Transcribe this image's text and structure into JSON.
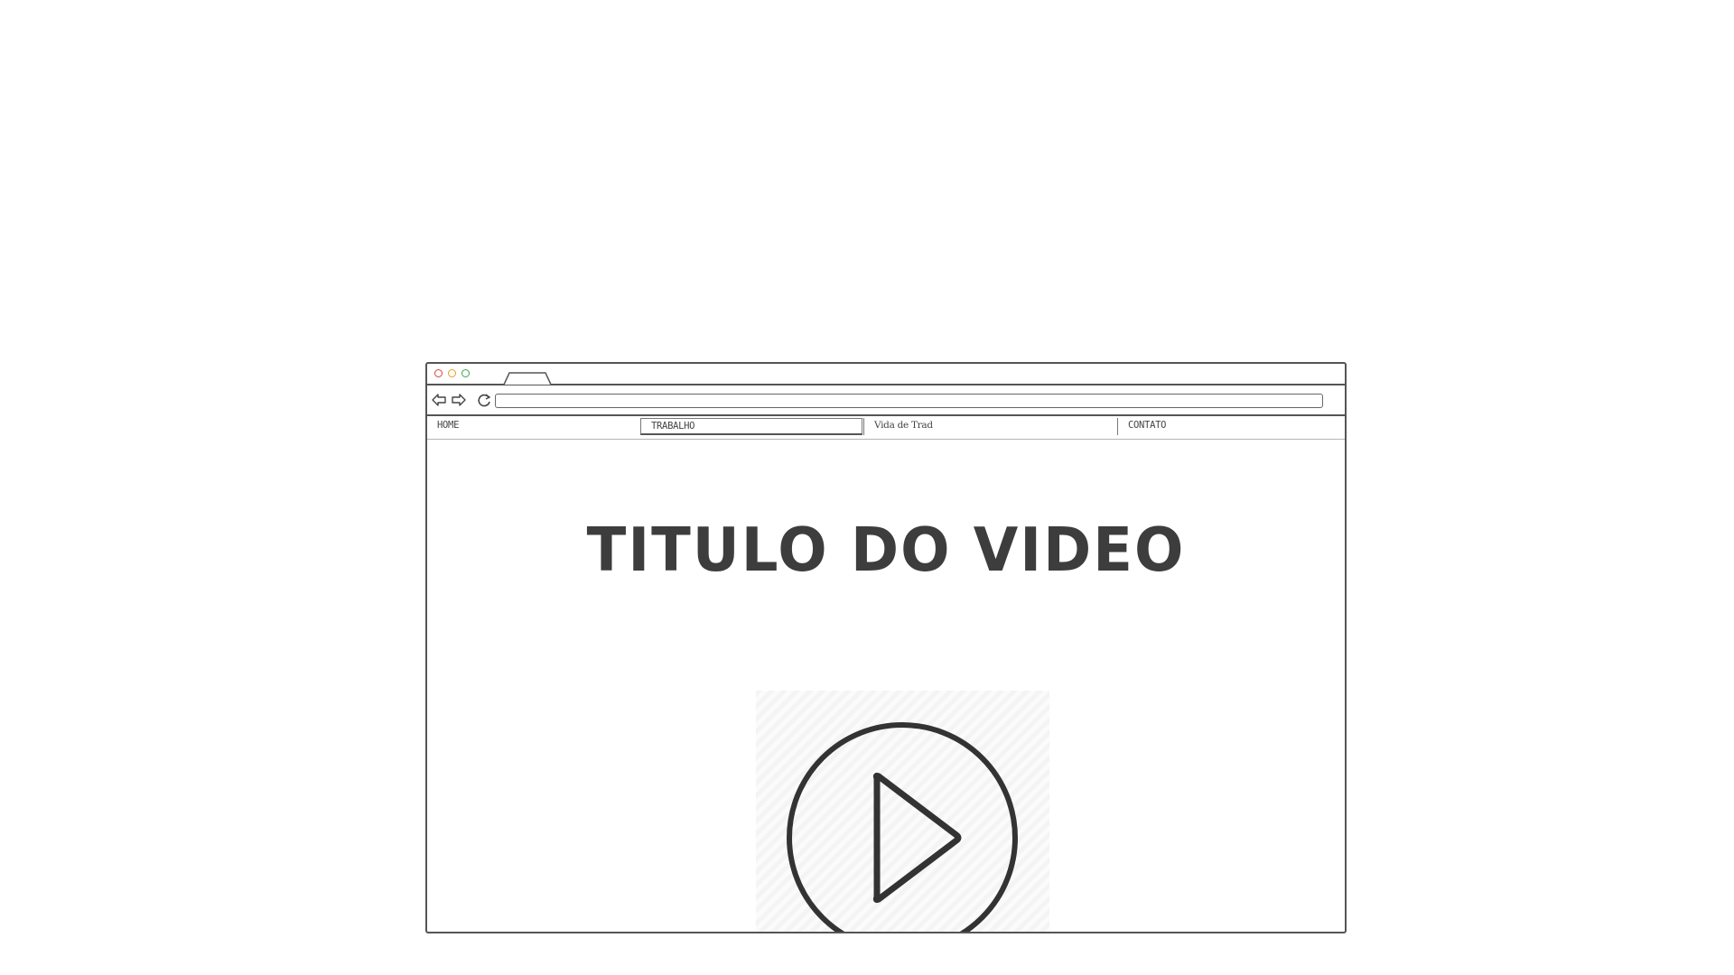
{
  "window": {
    "url": ""
  },
  "nav": {
    "items": [
      {
        "label": "HOME"
      },
      {
        "label": "TRABALHO"
      },
      {
        "label": "Vida de Trad"
      },
      {
        "label": "CONTATO"
      }
    ],
    "active_index": 1
  },
  "main": {
    "title": "TITULO DO VIDEO",
    "video_icon": "play-icon"
  },
  "colors": {
    "close": "#d64541",
    "minimize": "#e0a020",
    "maximize": "#3aa64a",
    "stroke": "#333333"
  }
}
